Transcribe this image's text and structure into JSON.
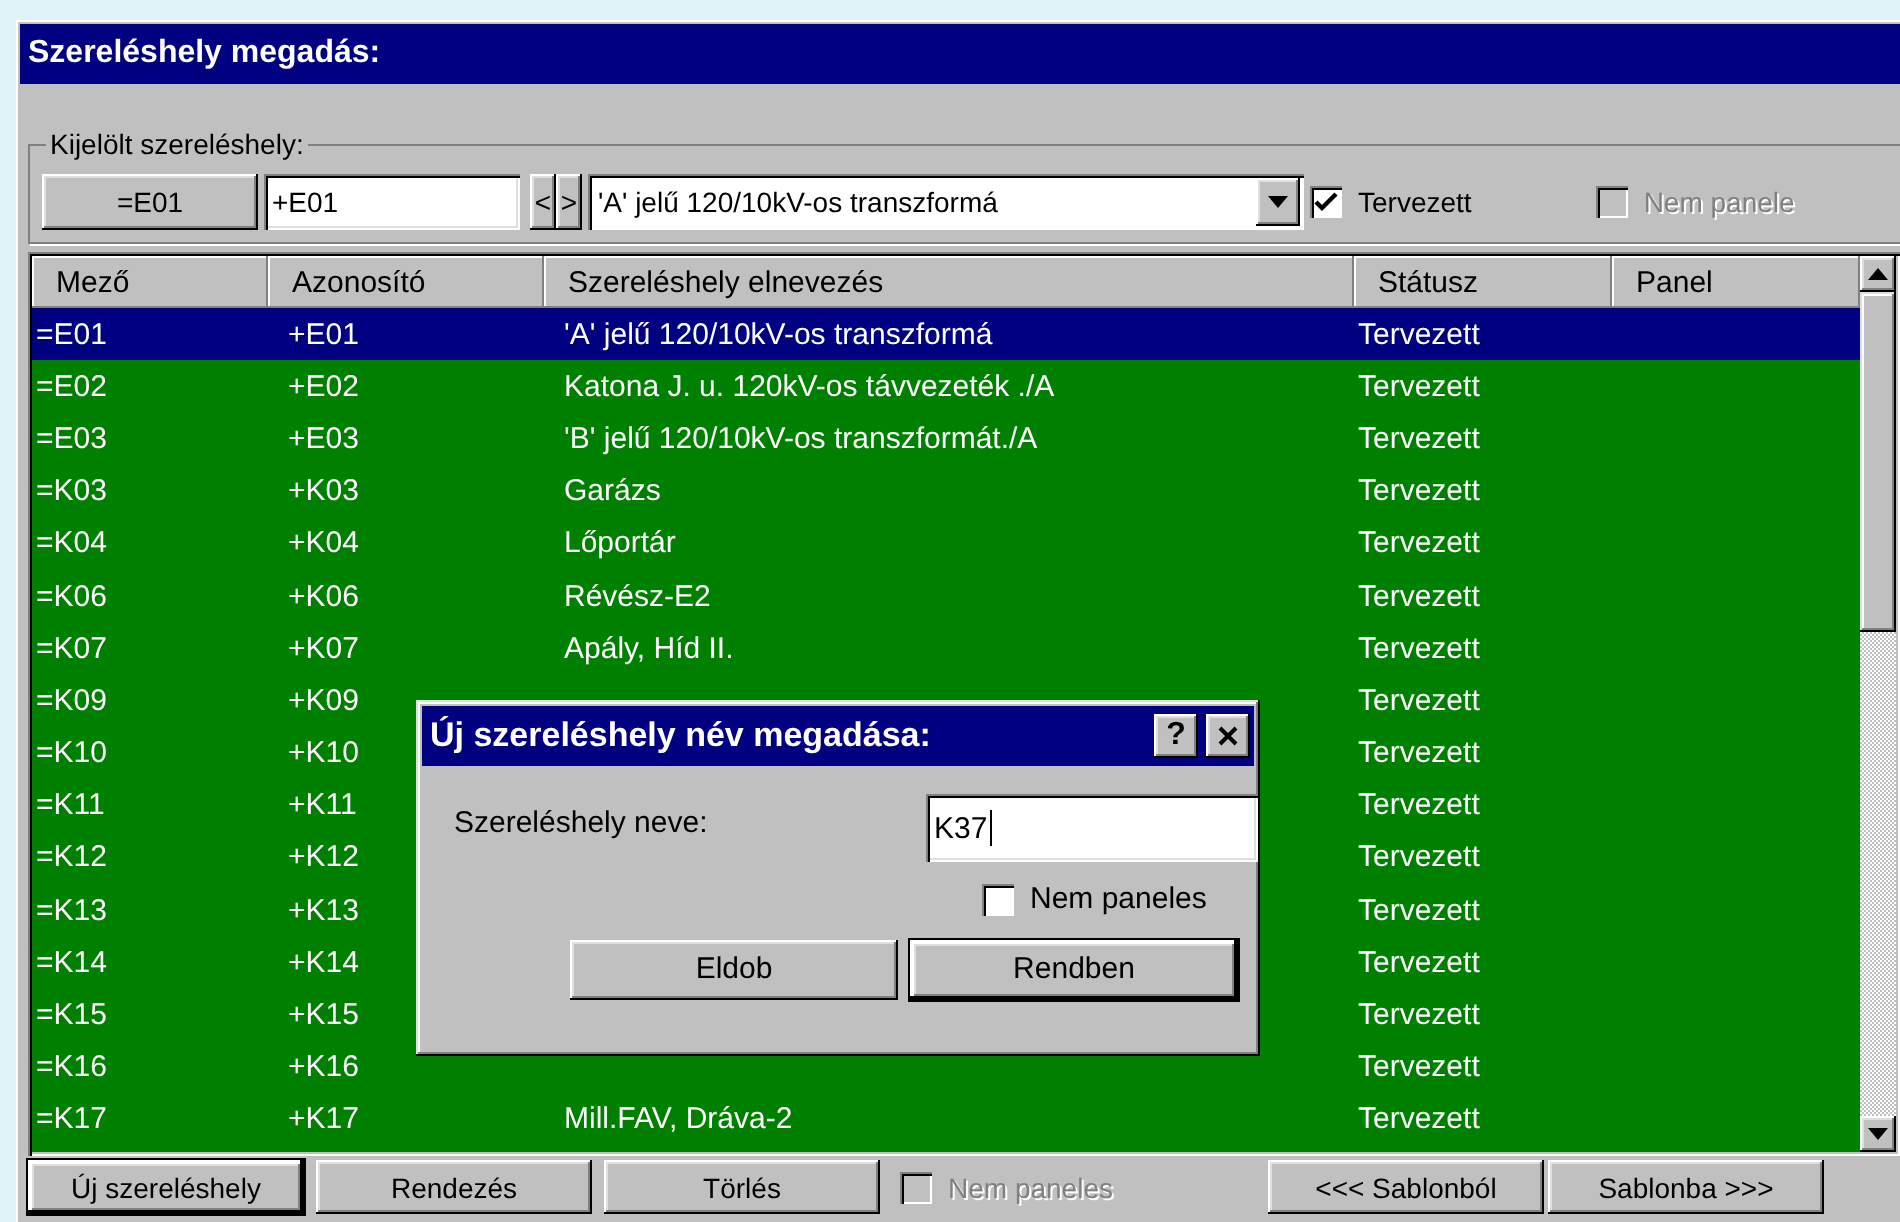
{
  "window": {
    "title": "Szereléshely megadás:"
  },
  "selected_location": {
    "group_label": "Kijelölt szereléshely:",
    "field_button": "=E01",
    "id_field": {
      "value": "+E01"
    },
    "prev": "<",
    "next": ">",
    "name_combo": {
      "value": "'A' jelű 120/10kV-os transzformá"
    },
    "planned": {
      "label": "Tervezett",
      "checked": true,
      "disabled": false
    },
    "not_panel": {
      "label": "Nem panele",
      "checked": false,
      "disabled": true
    }
  },
  "table": {
    "columns": [
      "Mező",
      "Azonosító",
      "Szereléshely elnevezés",
      "Státusz",
      "Panel"
    ],
    "rows": [
      {
        "field": "=E01",
        "id": "+E01",
        "name": "'A' jelű 120/10kV-os transzformá",
        "status": "Tervezett",
        "selected": true
      },
      {
        "field": "=E02",
        "id": "+E02",
        "name": "Katona J. u. 120kV-os távvezeték ./A",
        "status": "Tervezett",
        "selected": false
      },
      {
        "field": "=E03",
        "id": "+E03",
        "name": "'B' jelű 120/10kV-os transzformát./A",
        "status": "Tervezett",
        "selected": false
      },
      {
        "field": "=K03",
        "id": "+K03",
        "name": "Garázs",
        "status": "Tervezett",
        "selected": false
      },
      {
        "field": "=K04",
        "id": "+K04",
        "name": "Lőportár",
        "status": "Tervezett",
        "selected": false
      },
      {
        "field": "=K06",
        "id": "+K06",
        "name": "Révész-E2",
        "status": "Tervezett",
        "selected": false
      },
      {
        "field": "=K07",
        "id": "+K07",
        "name": "Apály, Híd II.",
        "status": "Tervezett",
        "selected": false
      },
      {
        "field": "=K09",
        "id": "+K09",
        "status": "Tervezett",
        "selected": false
      },
      {
        "field": "=K10",
        "id": "+K10",
        "status": "Tervezett",
        "selected": false
      },
      {
        "field": "=K11",
        "id": "+K11",
        "status": "Tervezett",
        "selected": false
      },
      {
        "field": "=K12",
        "id": "+K12",
        "status": "Tervezett",
        "selected": false
      },
      {
        "field": "=K13",
        "id": "+K13",
        "status": "Tervezett",
        "selected": false
      },
      {
        "field": "=K14",
        "id": "+K14",
        "status": "Tervezett",
        "selected": false
      },
      {
        "field": "=K15",
        "id": "+K15",
        "status": "Tervezett",
        "selected": false
      },
      {
        "field": "=K16",
        "id": "+K16",
        "status": "Tervezett",
        "selected": false
      },
      {
        "field": "=K17",
        "id": "+K17",
        "name": "Mill.FAV, Dráva-2",
        "status": "Tervezett",
        "selected": false
      }
    ]
  },
  "dialog": {
    "title": "Új szereléshely név megadása:",
    "help": "?",
    "name_label": "Szereléshely neve:",
    "name_field": {
      "value": "K37"
    },
    "not_panel": {
      "label": "Nem paneles",
      "checked": false,
      "disabled": false
    },
    "buttons": [
      {
        "label": "Eldob",
        "default": false
      },
      {
        "label": "Rendben",
        "default": true
      }
    ]
  },
  "bottom_bar": {
    "buttons": [
      {
        "label": "Új szereléshely",
        "default": true
      },
      {
        "label": "Rendezés",
        "default": false
      },
      {
        "label": "Törlés",
        "default": false
      }
    ],
    "not_panel": {
      "label": "Nem paneles",
      "checked": false,
      "disabled": true
    },
    "template_buttons": [
      {
        "label": "<<< Sablonból",
        "default": false
      },
      {
        "label": "Sablonba >>>",
        "default": false
      }
    ]
  }
}
